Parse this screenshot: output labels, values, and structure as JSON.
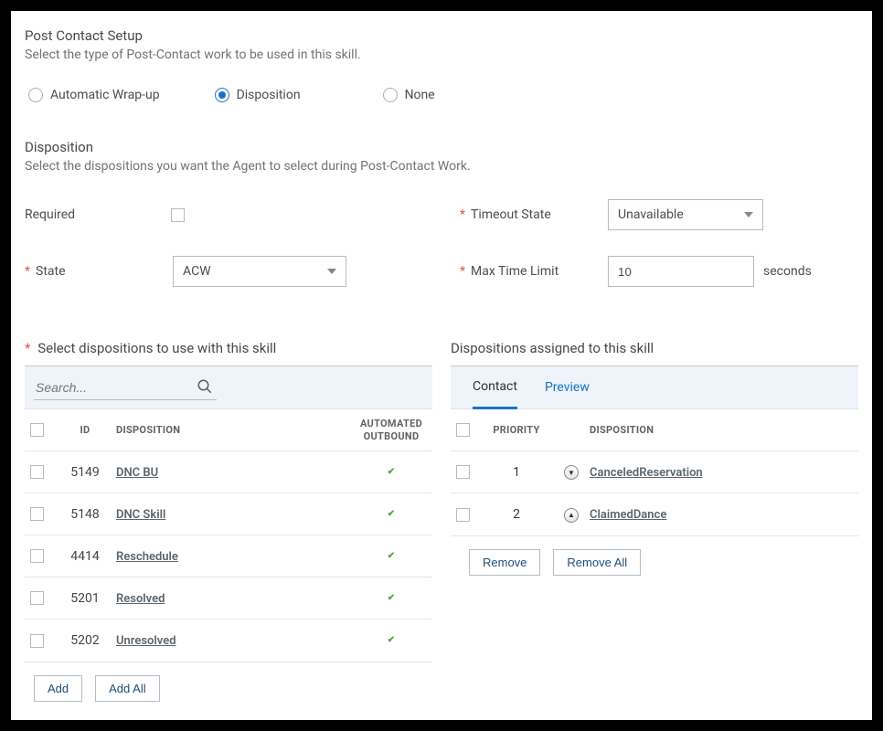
{
  "post_contact": {
    "title": "Post Contact Setup",
    "subtitle": "Select the type of Post-Contact work to be used in this skill.",
    "options": {
      "auto": "Automatic Wrap-up",
      "disposition": "Disposition",
      "none": "None"
    }
  },
  "disposition_section": {
    "title": "Disposition",
    "subtitle": "Select the dispositions you want the Agent to select during Post-Contact Work."
  },
  "labels": {
    "required": "Required",
    "state": "State",
    "timeout_state": "Timeout State",
    "max_time_limit": "Max Time Limit",
    "seconds": "seconds"
  },
  "values": {
    "state": "ACW",
    "timeout_state": "Unavailable",
    "max_time_limit": "10"
  },
  "left_panel": {
    "title": "Select dispositions to use with this skill",
    "search_placeholder": "Search...",
    "cols": {
      "id": "ID",
      "disposition": "DISPOSITION",
      "auto": "AUTOMATED OUTBOUND"
    },
    "rows": [
      {
        "id": "5149",
        "name": "DNC BU",
        "auto": true
      },
      {
        "id": "5148",
        "name": "DNC Skill",
        "auto": true
      },
      {
        "id": "4414",
        "name": "Reschedule",
        "auto": true
      },
      {
        "id": "5201",
        "name": "Resolved",
        "auto": true
      },
      {
        "id": "5202",
        "name": "Unresolved",
        "auto": true
      }
    ],
    "add": "Add",
    "add_all": "Add All"
  },
  "right_panel": {
    "title": "Dispositions assigned to this skill",
    "tabs": {
      "contact": "Contact",
      "preview": "Preview"
    },
    "cols": {
      "priority": "PRIORITY",
      "disposition": "DISPOSITION"
    },
    "rows": [
      {
        "priority": "1",
        "name": "CanceledReservation",
        "dir": "down"
      },
      {
        "priority": "2",
        "name": "ClaimedDance",
        "dir": "up"
      }
    ],
    "remove": "Remove",
    "remove_all": "Remove All"
  }
}
